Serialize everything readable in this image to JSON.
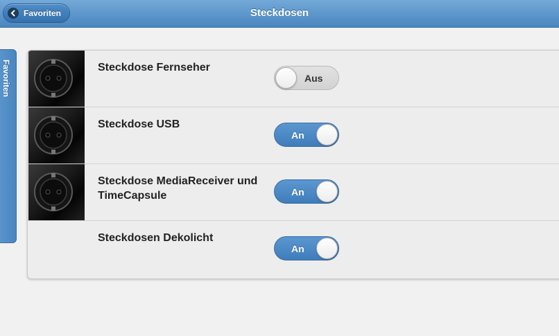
{
  "header": {
    "title": "Steckdosen",
    "back_label": "Favoriten"
  },
  "side_tab": {
    "label": "Favoriten"
  },
  "items": [
    {
      "label": "Steckdose Fernseher",
      "state": "Aus",
      "on": false,
      "has_image": true
    },
    {
      "label": "Steckdose USB",
      "state": "An",
      "on": true,
      "has_image": true
    },
    {
      "label": "Steckdose MediaReceiver und TimeCapsule",
      "state": "An",
      "on": true,
      "has_image": true
    },
    {
      "label": "Steckdosen Dekolicht",
      "state": "An",
      "on": true,
      "has_image": false
    }
  ],
  "colors": {
    "accent": "#4a86c0",
    "toggle_on": "#4a86c0",
    "toggle_off": "#d8d8d8"
  }
}
